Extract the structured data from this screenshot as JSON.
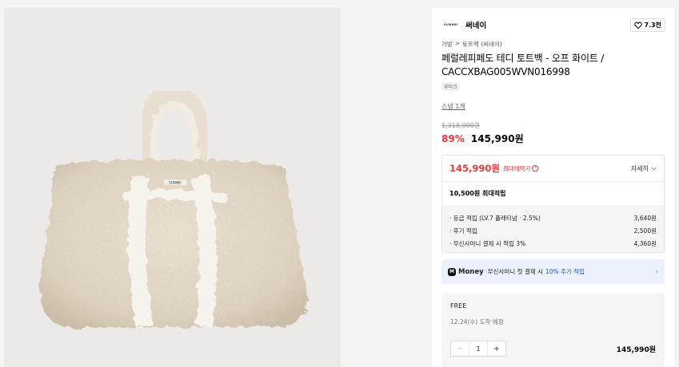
{
  "product_image": {
    "alt": "tote bag photo",
    "logo_text": "SUNNEI"
  },
  "brand": {
    "logo_text": "SUNNEI",
    "name": "써네이"
  },
  "like": {
    "icon": "heart-icon",
    "count": "7.3천"
  },
  "breadcrumb": {
    "items": [
      "가방",
      "토트백 (써네이)"
    ],
    "separator": ">"
  },
  "product": {
    "title": "페럴레피페도 테디 토트백 - 오프 화이트 / CACCXBAG005WVN016998",
    "tag": "부티크",
    "snap_link": "스냅 1개",
    "original_price": "1,318,000원",
    "discount": "89%",
    "sale_price": "145,990원"
  },
  "benefit": {
    "price": "145,990원",
    "max_label": "최대혜택가",
    "detail_label": "자세히",
    "points_summary": "10,500원 최대적립",
    "lines": [
      {
        "label": "· 등급 적립 (LV.7 플래티넘 · 2.5%)",
        "value": "3,640원"
      },
      {
        "label": "· 후기 적립",
        "value": "2,500원"
      },
      {
        "label": "· 무신사머니 결제 시 적립 3%",
        "value": "4,360원"
      }
    ]
  },
  "money_banner": {
    "logo": "M",
    "word": "Money",
    "text": "무신사머니 첫 결제 시",
    "highlight": "10% 추가 적립",
    "accent": "#1f54f0"
  },
  "order": {
    "shipping": "FREE",
    "arrival": "12.24(수) 도착 예정",
    "quantity": "1",
    "minus": "−",
    "plus": "+",
    "total": "145,990원"
  },
  "colors": {
    "sale_red": "#f0363c",
    "banner_bg": "#edf1fe"
  }
}
